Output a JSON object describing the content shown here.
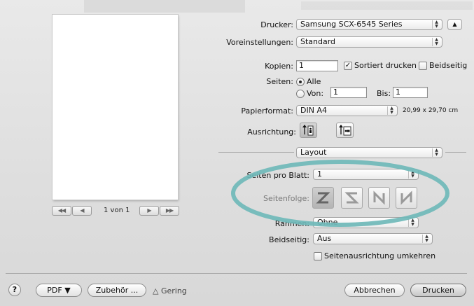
{
  "navigation": {
    "first_label": "◀◀",
    "prev_label": "◀",
    "page_info": "1 von 1",
    "next_label": "▶",
    "last_label": "▶▶"
  },
  "printer": {
    "label": "Drucker:",
    "value": "Samsung SCX-6545 Series"
  },
  "presets": {
    "label": "Voreinstellungen:",
    "value": "Standard"
  },
  "copies": {
    "label": "Kopien:",
    "value": "1",
    "collate_label": "Sortiert drucken",
    "collate_checked": true,
    "duplex_label": "Beidseitig",
    "duplex_checked": false
  },
  "pages": {
    "label": "Seiten:",
    "all_label": "Alle",
    "from_label": "Von:",
    "from_value": "1",
    "to_label": "Bis:",
    "to_value": "1",
    "selected": "all"
  },
  "paper": {
    "label": "Papierformat:",
    "value": "DIN A4",
    "size": "20,99 x 29,70 cm"
  },
  "orientation": {
    "label": "Ausrichtung:",
    "selected": "portrait"
  },
  "panel": {
    "value": "Layout"
  },
  "layout": {
    "pages_per_sheet_label": "Seiten pro Blatt:",
    "pages_per_sheet_value": "1",
    "order_label": "Seitenfolge:",
    "border_label": "Rahmen:",
    "border_value": "Ohne",
    "two_sided_label": "Beidseitig:",
    "two_sided_value": "Aus",
    "reverse_label": "Seitenausrichtung umkehren",
    "reverse_checked": false
  },
  "bottom": {
    "help_label": "?",
    "pdf_label": "PDF ▼",
    "supplies_label": "Zubehör ...",
    "supply_status": "Gering",
    "cancel_label": "Abbrechen",
    "print_label": "Drucken"
  },
  "annotation": {
    "color": "#6fb8b8"
  }
}
